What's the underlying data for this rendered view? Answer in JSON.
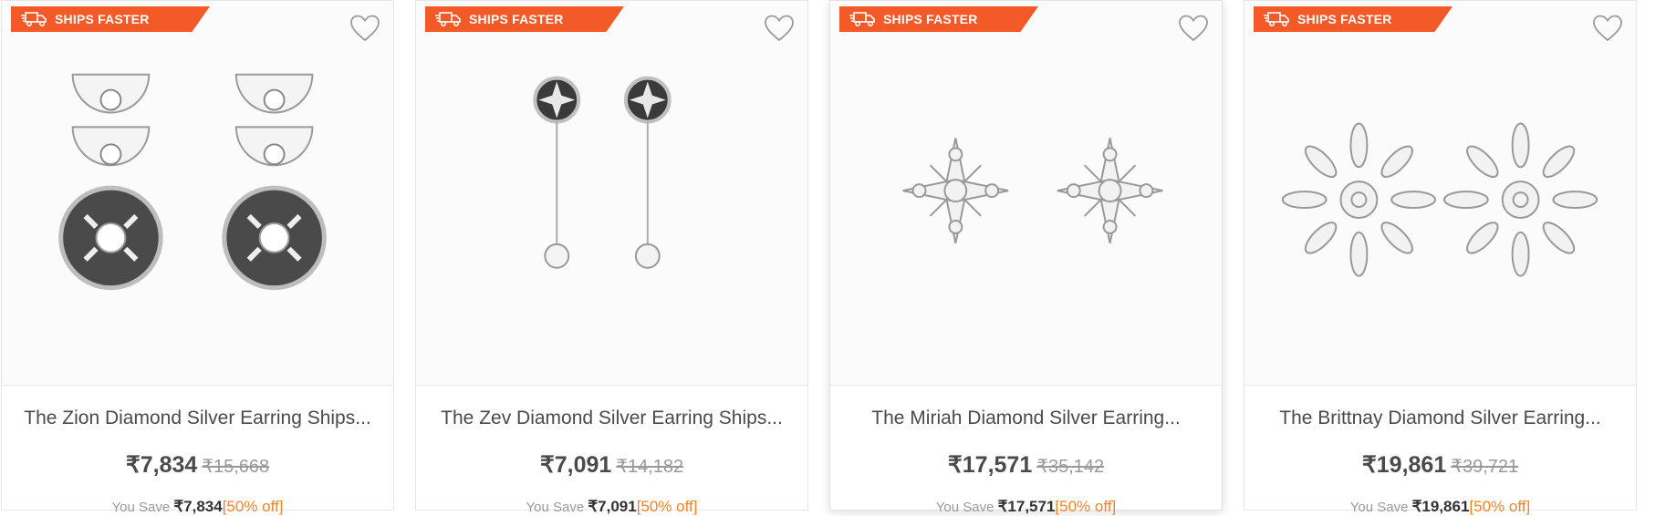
{
  "badge_label": "SHIPS FASTER",
  "save_prefix": "You Save",
  "products": [
    {
      "title": "The Zion Diamond Silver Earring Ships...",
      "price": "₹7,834",
      "mrp": "₹15,668",
      "save_amount": "₹7,834",
      "discount": "[50% off]"
    },
    {
      "title": "The Zev Diamond Silver Earring Ships...",
      "price": "₹7,091",
      "mrp": "₹14,182",
      "save_amount": "₹7,091",
      "discount": "[50% off]"
    },
    {
      "title": "The Miriah Diamond Silver Earring...",
      "price": "₹17,571",
      "mrp": "₹35,142",
      "save_amount": "₹17,571",
      "discount": "[50% off]"
    },
    {
      "title": "The Brittnay Diamond Silver Earring...",
      "price": "₹19,861",
      "mrp": "₹39,721",
      "save_amount": "₹19,861",
      "discount": "[50% off]"
    }
  ],
  "colors": {
    "badge_bg": "#f45a28",
    "discount": "#f5832a",
    "title_text": "#4a4a4a"
  }
}
